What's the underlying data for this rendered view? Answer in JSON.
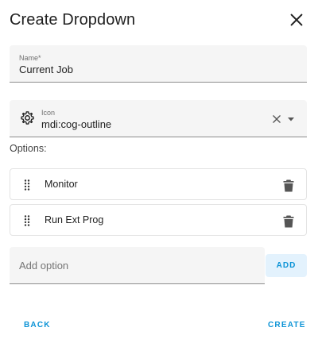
{
  "dialog": {
    "title": "Create Dropdown"
  },
  "name_field": {
    "label": "Name*",
    "value": "Current Job"
  },
  "icon_field": {
    "label": "Icon",
    "value": "mdi:cog-outline",
    "icon": "cog-outline-icon"
  },
  "options": {
    "label": "Options:",
    "items": [
      {
        "label": "Monitor"
      },
      {
        "label": "Run Ext Prog"
      }
    ]
  },
  "add_option": {
    "placeholder": "Add option",
    "button_label": "ADD"
  },
  "footer": {
    "back_label": "BACK",
    "create_label": "CREATE"
  },
  "colors": {
    "accent": "#0b93d6",
    "field_bg": "#f5f5f5"
  }
}
